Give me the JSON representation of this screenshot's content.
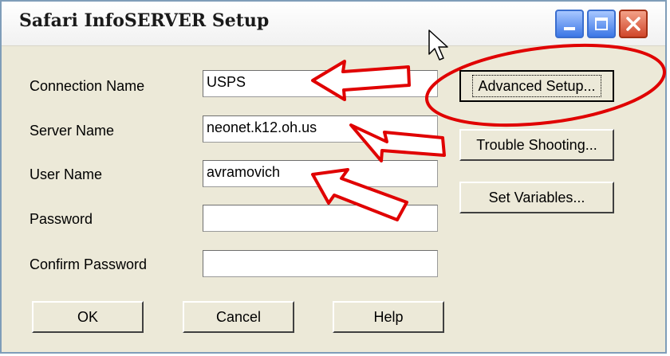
{
  "window": {
    "title": "Safari InfoSERVER Setup",
    "controls": [
      "minimize",
      "maximize",
      "close"
    ]
  },
  "form": {
    "connection_name": {
      "label": "Connection Name",
      "value": "USPS"
    },
    "server_name": {
      "label": "Server Name",
      "value": "neonet.k12.oh.us"
    },
    "user_name": {
      "label": "User Name",
      "value": "avramovich"
    },
    "password": {
      "label": "Password",
      "value": ""
    },
    "confirm_password": {
      "label": "Confirm Password",
      "value": ""
    }
  },
  "side_buttons": {
    "advanced": "Advanced Setup...",
    "trouble": "Trouble Shooting...",
    "variables": "Set Variables..."
  },
  "bottom_buttons": {
    "ok": "OK",
    "cancel": "Cancel",
    "help": "Help"
  },
  "annotations": {
    "arrow_color": "#e00000",
    "ellipse_color": "#e00000"
  }
}
